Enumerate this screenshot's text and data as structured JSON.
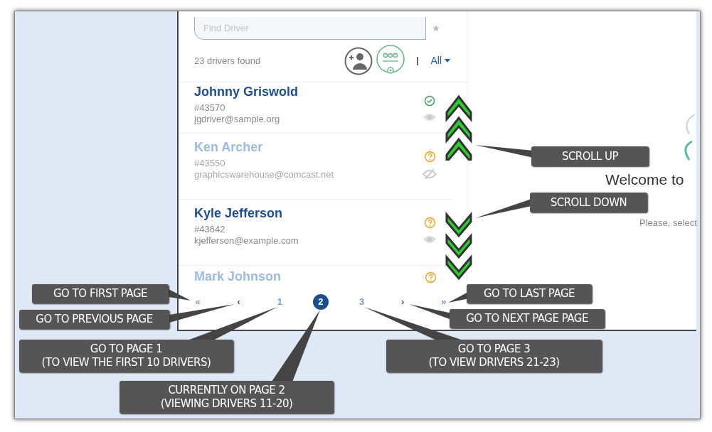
{
  "search": {
    "placeholder": "Find Driver"
  },
  "result_count": "23 drivers found",
  "filter": {
    "label": "All"
  },
  "drivers": [
    {
      "name": "Johnny Griswold",
      "number": "#43570",
      "email": "jgdriver@sample.org",
      "verified": true,
      "visible": true,
      "dimmed": false
    },
    {
      "name": "Ken Archer",
      "number": "#43550",
      "email": "graphicswarehouse@comcast.net",
      "verified": false,
      "visible": false,
      "dimmed": true
    },
    {
      "name": "Kyle Jefferson",
      "number": "#43642",
      "email": "kjefferson@example.com",
      "verified": false,
      "visible": true,
      "dimmed": false
    },
    {
      "name": "Mark Johnson",
      "verified": false,
      "dimmed": true
    }
  ],
  "pagination": [
    {
      "label": "«",
      "kind": "first",
      "selected": false
    },
    {
      "label": "‹",
      "kind": "prev",
      "selected": false
    },
    {
      "label": "1",
      "kind": "page",
      "selected": false
    },
    {
      "label": "2",
      "kind": "page",
      "selected": true
    },
    {
      "label": "3",
      "kind": "page",
      "selected": false
    },
    {
      "label": "›",
      "kind": "next",
      "selected": false
    },
    {
      "label": "»",
      "kind": "last",
      "selected": false
    }
  ],
  "welcome": {
    "title": "Welcome to",
    "subtitle": "Please, select"
  },
  "callouts": [
    {
      "lines": [
        "SCROLL UP"
      ]
    },
    {
      "lines": [
        "SCROLL DOWN"
      ]
    },
    {
      "lines": [
        "GO TO FIRST PAGE"
      ]
    },
    {
      "lines": [
        "GO TO LAST PAGE"
      ]
    },
    {
      "lines": [
        "GO TO PREVIOUS PAGE"
      ]
    },
    {
      "lines": [
        "GO TO NEXT PAGE PAGE"
      ]
    },
    {
      "lines": [
        "GO TO PAGE 1",
        "(TO VIEW THE FIRST 10 DRIVERS)"
      ]
    },
    {
      "lines": [
        "GO TO PAGE 3",
        "(TO VIEW DRIVERS 21-23)"
      ]
    },
    {
      "lines": [
        "CURRENTLY ON PAGE 2",
        "(VIEWING DRIVERS 11-20)"
      ]
    }
  ]
}
